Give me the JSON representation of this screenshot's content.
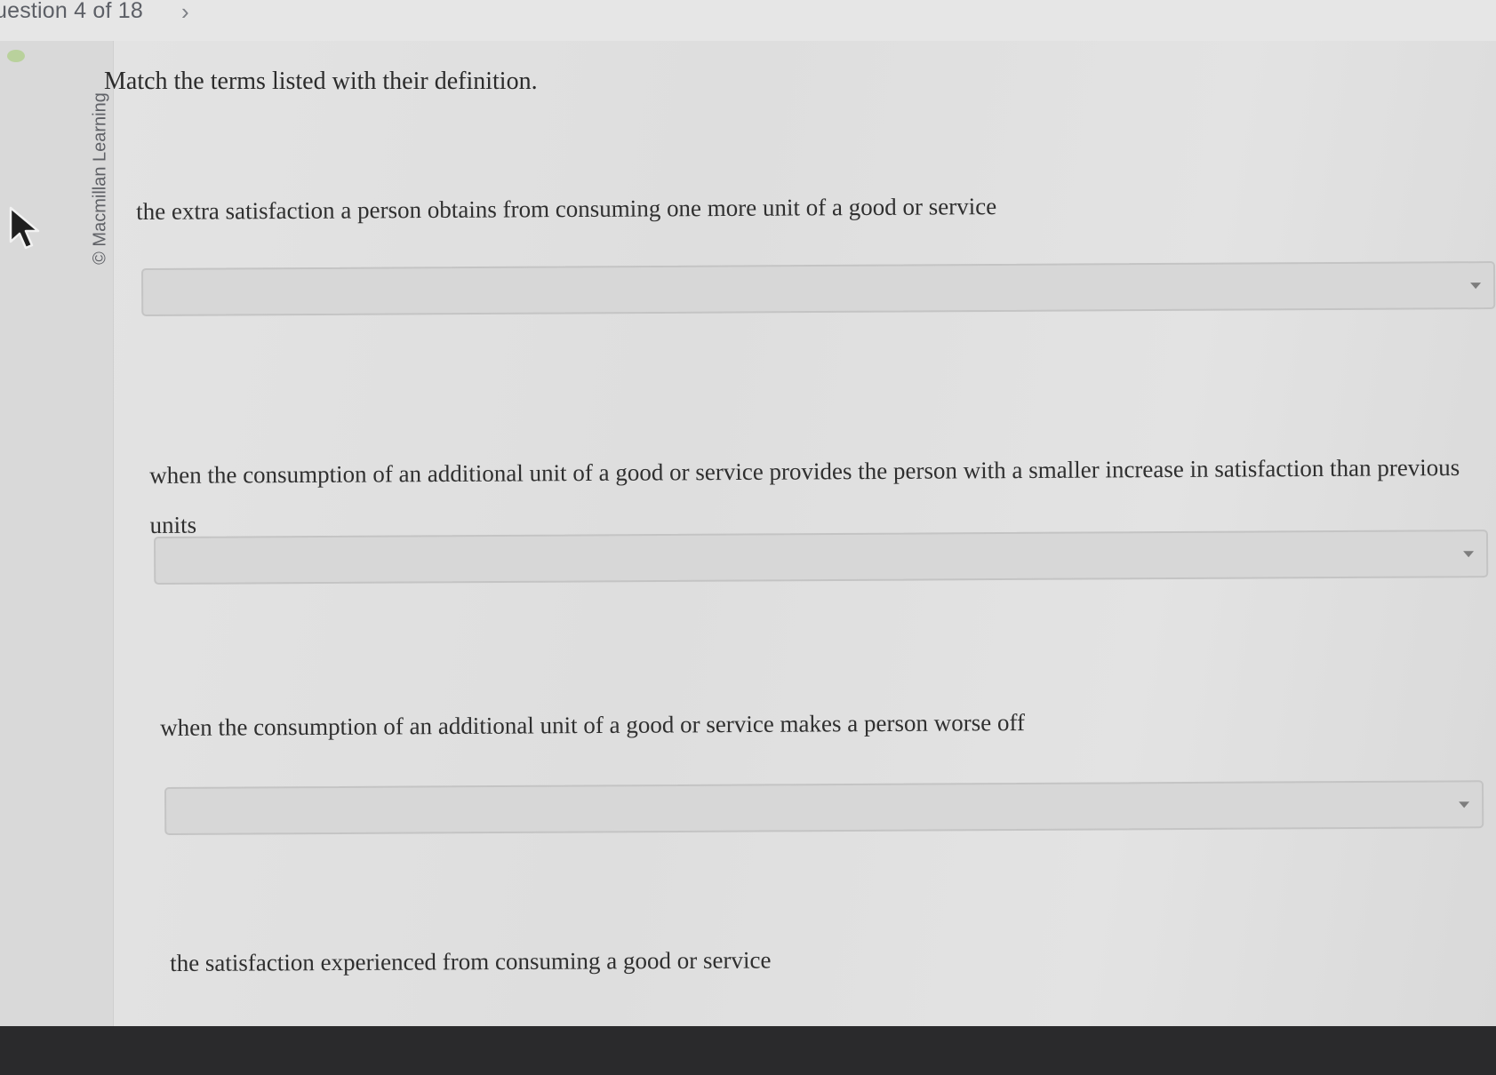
{
  "header": {
    "question_counter": "uestion 4 of 18",
    "next_chevron": "›"
  },
  "copyright": "© Macmillan Learning",
  "prompt": "Match the terms listed with their definition.",
  "items": [
    {
      "definition": "the extra satisfaction a person obtains from consuming one more unit of a good or service",
      "selected_value": ""
    },
    {
      "definition": "when the consumption of an additional unit of a good or service provides the person with a smaller increase in satisfaction than previous units",
      "selected_value": ""
    },
    {
      "definition": "when the consumption of an additional unit of a good or service makes a person worse off",
      "selected_value": ""
    },
    {
      "definition": "the satisfaction experienced from consuming a good or service",
      "selected_value": ""
    }
  ],
  "icons": {
    "cursor": "arrow-cursor-icon",
    "dropdown": "chevron-down-icon"
  },
  "colors": {
    "status_dot": "#b9d19c",
    "dropdown_bg": "#d7d7d7"
  }
}
